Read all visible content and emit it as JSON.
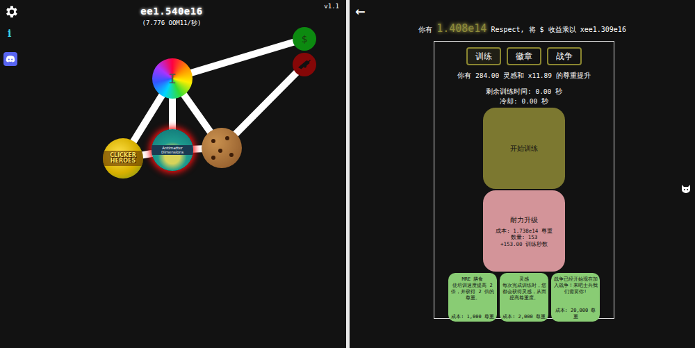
{
  "left": {
    "score": "ee1.540e16",
    "rate": "(7.776 OOM11/秒)",
    "version": "v1.1",
    "info": "i",
    "nodes": [
      {
        "kind": "rainbow",
        "label": "I",
        "selected": false
      },
      {
        "kind": "dollar",
        "label": "$",
        "selected": false
      },
      {
        "kind": "war",
        "label": "",
        "selected": false
      },
      {
        "kind": "clicker",
        "label": "CLICKER HEROES",
        "selected": false
      },
      {
        "kind": "antimatter",
        "label": "Antimatter Dimensions",
        "selected": true
      },
      {
        "kind": "cookie",
        "label": "",
        "selected": false
      }
    ]
  },
  "right": {
    "back": "←",
    "header": {
      "prefix": "你有",
      "amount": "1.408e14",
      "suffix": "Respect, 将 $ 收益乘以 xee1.309e16"
    },
    "tabs": [
      {
        "label": "训练",
        "selected": true
      },
      {
        "label": "徽章",
        "selected": false
      },
      {
        "label": "战争",
        "selected": false
      }
    ],
    "boost": "你有 284.00 灵感和 x11.89 的尊重提升",
    "remaining": "剩余训练时间: 0.00 秒",
    "cooldown": "冷却: 0.00 秒",
    "start_button": "开始训练",
    "stamina": {
      "title": "耐力升级",
      "cost": "成本: 1.738e14 尊重",
      "count": "数量: 153",
      "effect": "+153.00 训练秒数"
    },
    "upgrades": [
      {
        "title": "MRE 膳食",
        "desc": "使培训速度提高 2 倍，并获得 2 倍的尊重。",
        "cost": "成本: 1,000 尊重"
      },
      {
        "title": "灵感",
        "desc": "每次完成训练时，您都会获得灵感，从而提高尊重度。",
        "cost": "成本: 2,000 尊重"
      },
      {
        "title": "",
        "desc": "战争已经开始现在加入战争！来吧士兵我们需要你!",
        "cost": "成本: 20,000 尊重"
      }
    ]
  }
}
